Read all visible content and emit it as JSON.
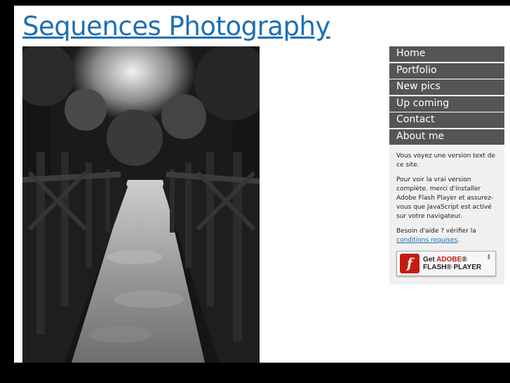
{
  "site": {
    "title": "Sequences Photography"
  },
  "nav": {
    "items": [
      {
        "label": "Home"
      },
      {
        "label": "Portfolio"
      },
      {
        "label": "New pics"
      },
      {
        "label": "Up coming"
      },
      {
        "label": "Contact"
      },
      {
        "label": "About me"
      }
    ]
  },
  "notice": {
    "text_version": "Vous voyez une version text de ce site.",
    "install_flash": "Pour voir la vrai version complète. merci d'installer Adobe Flash Player et assurez-vous que JavaScript est activé sur votre navigateur.",
    "help_prefix": "Besoin d'aide ? vérifier la",
    "help_link": "conditions requises",
    "help_suffix": "."
  },
  "flash_badge": {
    "line1_prefix": "Get ",
    "line1_brand": "ADOBE",
    "line1_reg": "®",
    "line2": "FLASH® PLAYER",
    "logo_letter": "f"
  },
  "colors": {
    "link": "#1f6fb2",
    "nav_bg": "#555555",
    "info_bg": "#f0f0f0",
    "flash_red": "#c41c10"
  },
  "image": {
    "subject": "black-and-white wooden footbridge path"
  }
}
